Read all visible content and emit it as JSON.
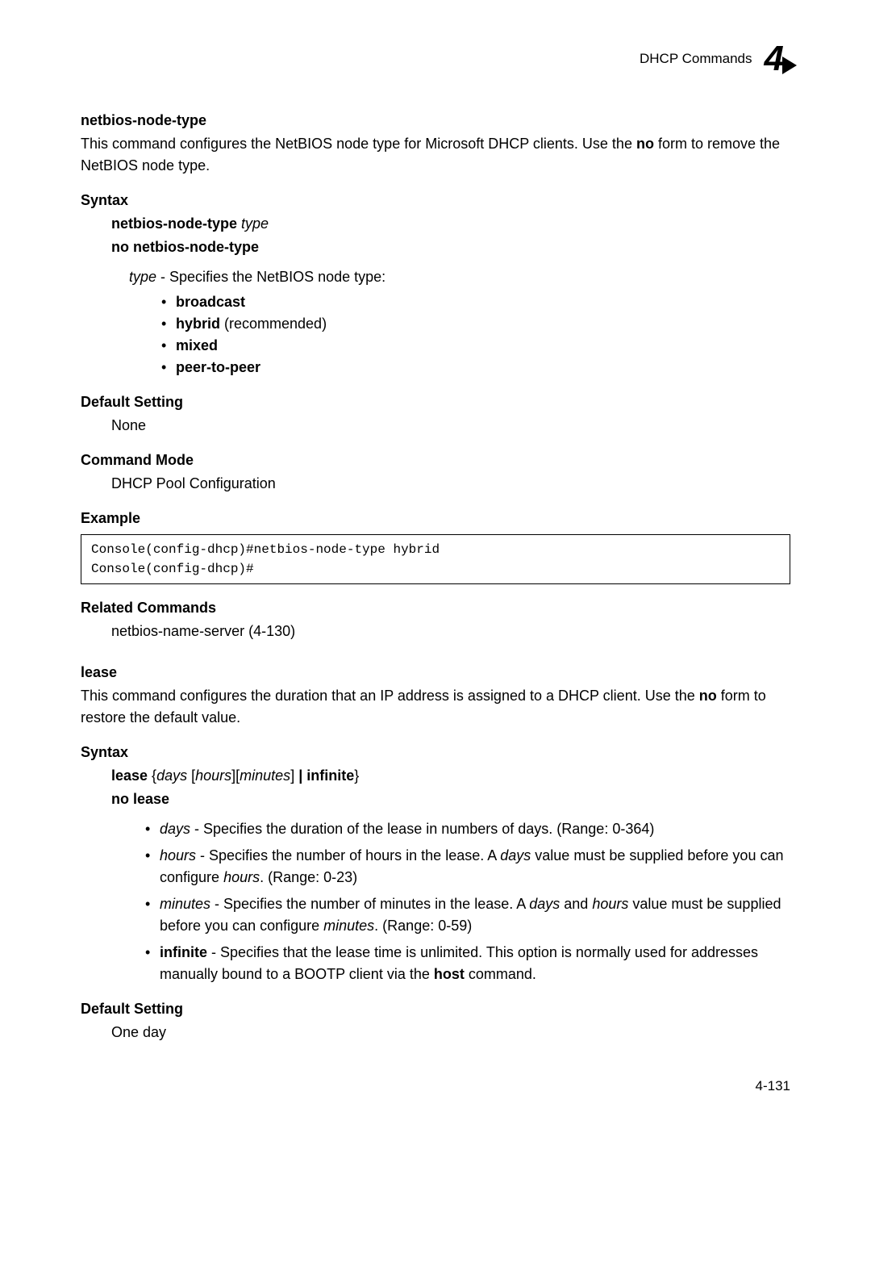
{
  "header": {
    "section": "DHCP Commands",
    "chapter_number": "4"
  },
  "cmd1": {
    "title": "netbios-node-type",
    "description_1": "This command configures the NetBIOS node type for Microsoft DHCP clients. Use the ",
    "description_no": "no",
    "description_2": " form to remove the NetBIOS node type.",
    "syntax_label": "Syntax",
    "syntax_line1_cmd": "netbios-node-type ",
    "syntax_line1_arg": "type",
    "syntax_line2": "no netbios-node-type",
    "type_arg": "type",
    "type_desc": " - Specifies the NetBIOS node type:",
    "types": {
      "broadcast": "broadcast",
      "hybrid_bold": "hybrid",
      "hybrid_rest": " (recommended)",
      "mixed": "mixed",
      "peer": "peer-to-peer"
    },
    "default_label": "Default Setting",
    "default_value": "None",
    "mode_label": "Command Mode",
    "mode_value": "DHCP Pool Configuration",
    "example_label": "Example",
    "example_code": "Console(config-dhcp)#netbios-node-type hybrid\nConsole(config-dhcp)#",
    "related_label": "Related Commands",
    "related_value": "netbios-name-server (4-130)"
  },
  "cmd2": {
    "title": "lease",
    "description_1": "This command configures the duration that an IP address is assigned to a DHCP client. Use the ",
    "description_no": "no",
    "description_2": " form to restore the default value.",
    "syntax_label": "Syntax",
    "syntax_lease": "lease",
    "syntax_brace_open": " {",
    "syntax_days": "days",
    "syntax_sp_open1": " [",
    "syntax_hours": "hours",
    "syntax_close_open": "][",
    "syntax_minutes": "minutes",
    "syntax_close1": "] ",
    "syntax_pipe": "| ",
    "syntax_infinite": "infinite",
    "syntax_brace_close": "}",
    "syntax_no": "no lease",
    "params": {
      "days_arg": "days",
      "days_desc": " - Specifies the duration of the lease in numbers of days. (Range: 0-364)",
      "hours_arg": "hours",
      "hours_desc_1": " - Specifies the number of hours in the lease. A ",
      "hours_days_it": "days",
      "hours_desc_2": " value must be supplied before you can configure ",
      "hours_hours_it": "hours",
      "hours_desc_3": ". (Range: 0-23)",
      "minutes_arg": "minutes",
      "minutes_desc_1": " - Specifies the number of minutes in the lease. A ",
      "minutes_days_it": "days",
      "minutes_desc_2": " and ",
      "minutes_hours_it": "hours",
      "minutes_desc_3": " value must be supplied before you can configure ",
      "minutes_minutes_it": "minutes",
      "minutes_desc_4": ". (Range: 0-59)",
      "infinite_arg": "infinite",
      "infinite_desc_1": " - Specifies that the lease time is unlimited. This option is normally used for addresses manually bound to a BOOTP client via the ",
      "infinite_host": "host",
      "infinite_desc_2": " command."
    },
    "default_label": "Default Setting",
    "default_value": "One day"
  },
  "page_number": "4-131"
}
